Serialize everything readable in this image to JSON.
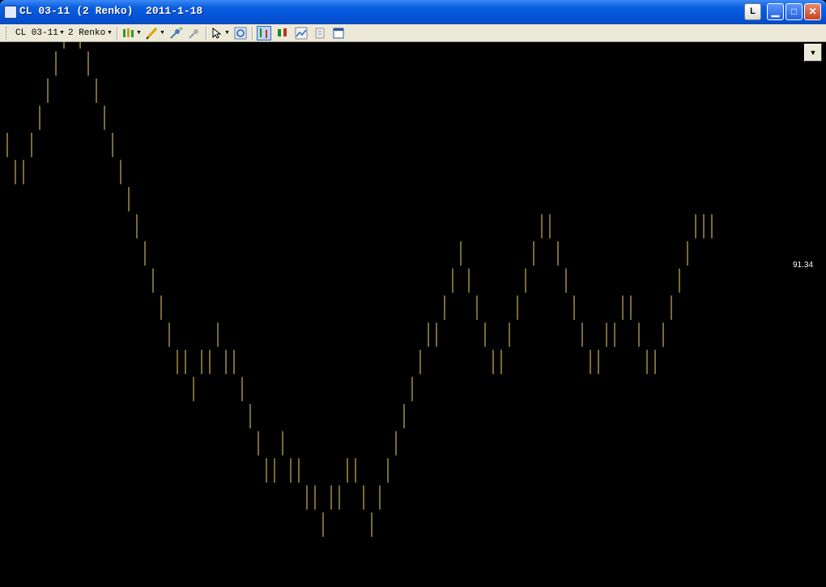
{
  "window": {
    "title": "CL 03-11 (2 Renko)  2011-1-18",
    "buttons": {
      "l_label": "L",
      "minimize": "▁",
      "maximize": "□",
      "close": "✕"
    }
  },
  "toolbar": {
    "symbol": "CL 03-11",
    "period": "2 Renko",
    "icons": [
      "candlestick-icon",
      "pencil-icon",
      "pin-add-icon",
      "pin-remove-icon",
      "cursor-icon",
      "zoom-icon",
      "bars-icon",
      "candles-icon",
      "area-icon",
      "scroll-icon",
      "window-icon"
    ]
  },
  "chart": {
    "price_label": "91.34",
    "colors": {
      "background": "#000000",
      "brick_wick": "#f5d36a"
    },
    "chart_data": {
      "type": "renko",
      "y_steps_from_lowest": [
        14,
        13,
        13,
        14,
        15,
        16,
        17,
        18,
        19,
        18,
        17,
        16,
        15,
        14,
        13,
        12,
        11,
        10,
        9,
        8,
        7,
        6,
        6,
        5,
        6,
        6,
        7,
        6,
        6,
        5,
        4,
        3,
        2,
        2,
        3,
        2,
        2,
        1,
        1,
        0,
        1,
        1,
        2,
        2,
        1,
        0,
        1,
        2,
        3,
        4,
        5,
        6,
        7,
        7,
        8,
        9,
        10,
        9,
        8,
        7,
        6,
        6,
        7,
        8,
        9,
        10,
        11,
        11,
        10,
        9,
        8,
        7,
        6,
        6,
        7,
        7,
        8,
        8,
        7,
        6,
        6,
        7,
        8,
        9,
        10,
        11,
        11,
        11
      ]
    }
  }
}
